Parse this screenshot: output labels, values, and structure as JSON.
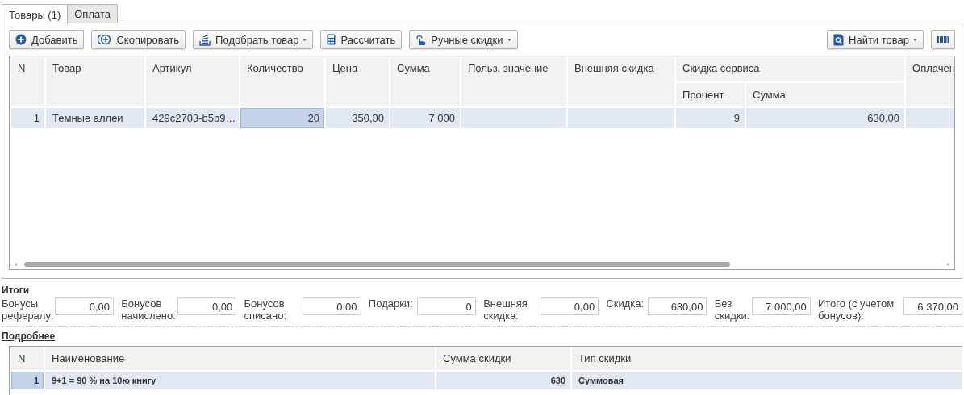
{
  "tabs": [
    {
      "label": "Товары (1)",
      "selected": true
    },
    {
      "label": "Оплата",
      "selected": false
    }
  ],
  "toolbar": {
    "left": [
      {
        "label": "Добавить",
        "dropdown": false
      },
      {
        "label": "Скопировать",
        "dropdown": false
      },
      {
        "label": "Подобрать товар",
        "dropdown": true
      },
      {
        "label": "Рассчитать",
        "dropdown": false
      },
      {
        "label": "Ручные скидки",
        "dropdown": true
      }
    ],
    "right": [
      {
        "label": "Найти товар",
        "dropdown": true
      }
    ]
  },
  "goods_table": {
    "columns": [
      {
        "label": "N",
        "kind": "number"
      },
      {
        "label": "Товар",
        "kind": "text"
      },
      {
        "label": "Артикул",
        "kind": "text"
      },
      {
        "label": "Количество",
        "kind": "number"
      },
      {
        "label": "Цена",
        "kind": "number"
      },
      {
        "label": "Сумма",
        "kind": "number"
      },
      {
        "label": "Польз. значение",
        "kind": "text"
      },
      {
        "label": "Внешняя скидка",
        "kind": "number"
      },
      {
        "label": "Скидка сервиса",
        "colspan": 2,
        "children": [
          {
            "label": "Процент",
            "kind": "number"
          },
          {
            "label": "Сумма",
            "kind": "number"
          }
        ]
      },
      {
        "label": "Оплачен",
        "kind": "number"
      }
    ],
    "rows": [
      {
        "selected": true,
        "cells": [
          "1",
          "Темные аллеи",
          "429c2703-b5b9…",
          {
            "text": "20",
            "focused": true
          },
          "350,00",
          "7 000",
          null,
          null,
          "9",
          "630,00",
          null
        ]
      }
    ]
  },
  "totals": {
    "title": "Итоги",
    "fields": [
      {
        "label": "Бонусы рефералу:",
        "value": "0,00"
      },
      {
        "label": "Бонусов начислено:",
        "value": "0,00"
      },
      {
        "label": "Бонусов списано:",
        "value": "0,00"
      },
      {
        "label": "Подарки:",
        "value": "0"
      },
      {
        "label": "Внешняя скидка:",
        "value": "0,00"
      },
      {
        "label": "Скидка:",
        "value": "630,00"
      },
      {
        "label": "Без скидки:",
        "value": "7 000,00"
      },
      {
        "label": "Итого (с учетом бонусов):",
        "value": "6 370,00"
      }
    ]
  },
  "details": {
    "title": "Подробнее",
    "columns": [
      {
        "label": "N",
        "kind": "number"
      },
      {
        "label": "Наименование",
        "kind": "text"
      },
      {
        "label": "Сумма скидки",
        "kind": "number"
      },
      {
        "label": "Тип скидки",
        "kind": "text"
      }
    ],
    "rows": [
      {
        "selected": true,
        "cells": [
          {
            "text": "1",
            "focused": true
          },
          "9+1 = 90 % на 10ю книгу",
          "630",
          "Суммовая"
        ]
      }
    ]
  }
}
